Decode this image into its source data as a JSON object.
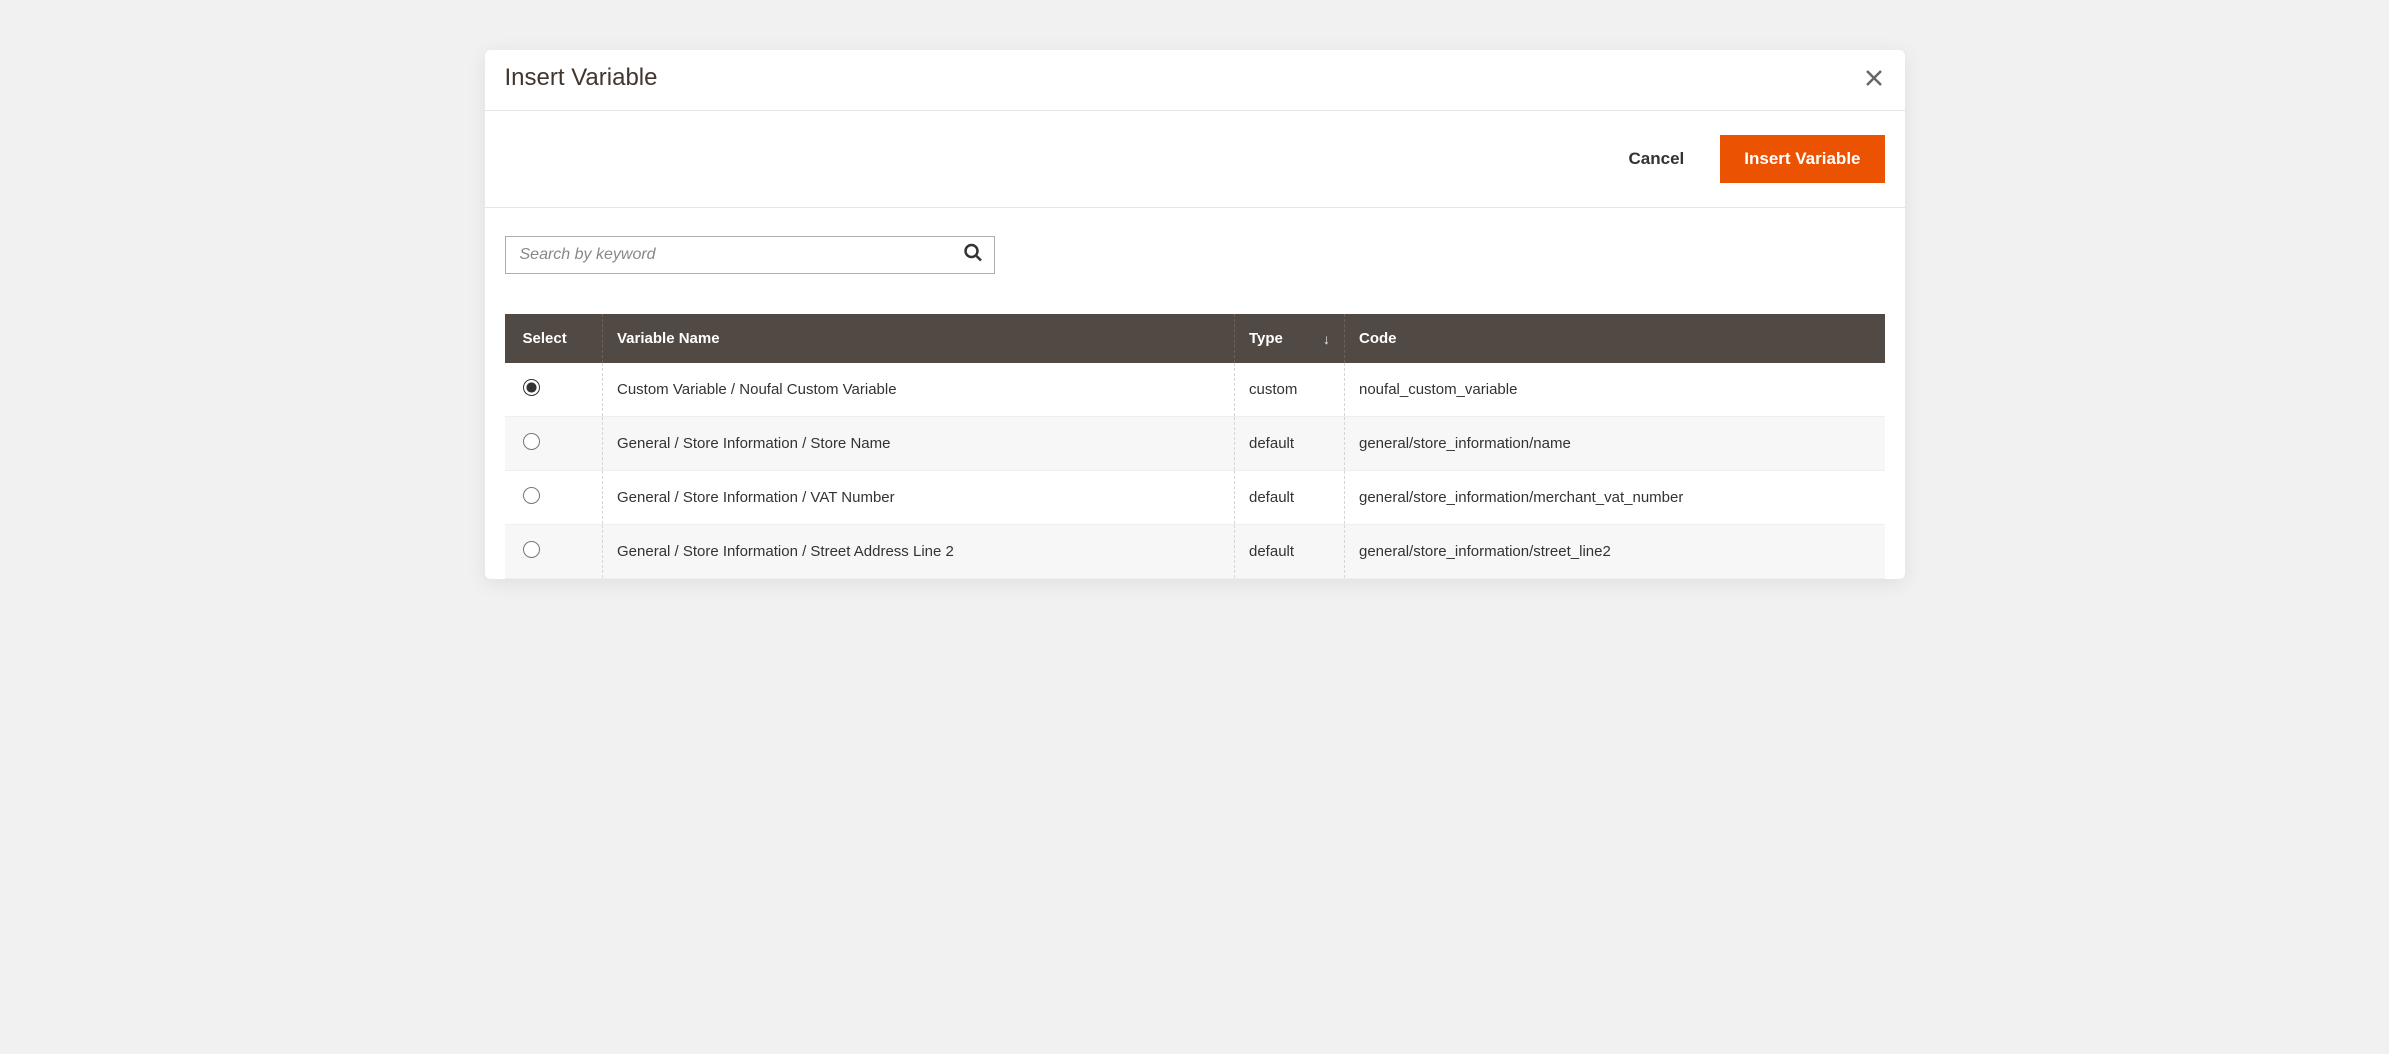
{
  "modal": {
    "title": "Insert Variable"
  },
  "actions": {
    "cancel": "Cancel",
    "insert": "Insert Variable"
  },
  "search": {
    "placeholder": "Search by keyword"
  },
  "table": {
    "headers": {
      "select": "Select",
      "name": "Variable Name",
      "type": "Type",
      "code": "Code"
    },
    "sort_indicator": "↓",
    "rows": [
      {
        "selected": true,
        "name": "Custom Variable / Noufal Custom Variable",
        "type": "custom",
        "code": "noufal_custom_variable"
      },
      {
        "selected": false,
        "name": "General / Store Information / Store Name",
        "type": "default",
        "code": "general/store_information/name"
      },
      {
        "selected": false,
        "name": "General / Store Information / VAT Number",
        "type": "default",
        "code": "general/store_information/merchant_vat_number"
      },
      {
        "selected": false,
        "name": "General / Store Information / Street Address Line 2",
        "type": "default",
        "code": "general/store_information/street_line2"
      }
    ]
  }
}
